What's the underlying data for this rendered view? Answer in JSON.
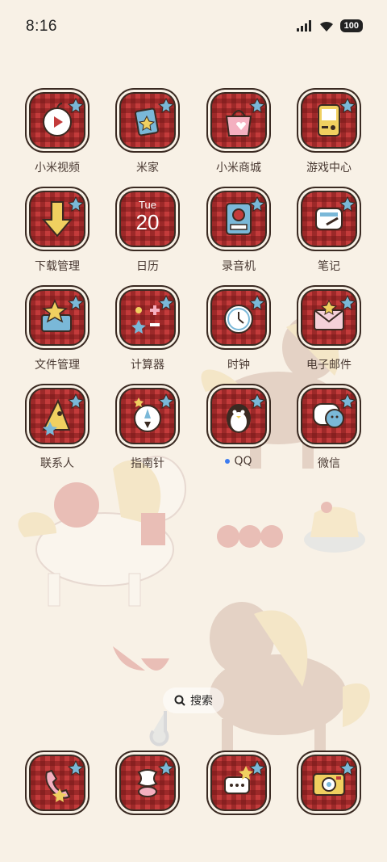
{
  "status_bar": {
    "time": "8:16",
    "battery": "100"
  },
  "apps": [
    {
      "id": "mi-video",
      "label": "小米视频",
      "icon": "apple-video-icon"
    },
    {
      "id": "mi-home",
      "label": "米家",
      "icon": "cup-star-icon"
    },
    {
      "id": "mi-store",
      "label": "小米商城",
      "icon": "shopping-bag-icon"
    },
    {
      "id": "game-center",
      "label": "游戏中心",
      "icon": "gameboy-icon"
    },
    {
      "id": "downloads",
      "label": "下载管理",
      "icon": "download-arrow-icon"
    },
    {
      "id": "calendar",
      "label": "日历",
      "icon": "calendar-icon"
    },
    {
      "id": "recorder",
      "label": "录音机",
      "icon": "recorder-icon"
    },
    {
      "id": "notes",
      "label": "笔记",
      "icon": "notepad-icon"
    },
    {
      "id": "files",
      "label": "文件管理",
      "icon": "folder-star-icon"
    },
    {
      "id": "calculator",
      "label": "计算器",
      "icon": "calculator-icon"
    },
    {
      "id": "clock",
      "label": "时钟",
      "icon": "clock-icon"
    },
    {
      "id": "mail",
      "label": "电子邮件",
      "icon": "envelope-icon"
    },
    {
      "id": "contacts",
      "label": "联系人",
      "icon": "contacts-icon"
    },
    {
      "id": "compass",
      "label": "指南针",
      "icon": "compass-icon"
    },
    {
      "id": "qq",
      "label": "QQ",
      "icon": "penguin-icon"
    },
    {
      "id": "wechat",
      "label": "微信",
      "icon": "chat-bubble-icon"
    }
  ],
  "calendar": {
    "day": "Tue",
    "date": "20"
  },
  "search": {
    "label": "搜索"
  },
  "dock": [
    {
      "id": "phone",
      "icon": "phone-icon"
    },
    {
      "id": "gallery",
      "icon": "apple-core-icon"
    },
    {
      "id": "messages",
      "icon": "message-bubble-icon"
    },
    {
      "id": "camera",
      "icon": "camera-icon"
    }
  ],
  "colors": {
    "background": "#f8f1e6",
    "icon_red": "#c33b3b",
    "outline": "#3a2a22",
    "label": "#4a3a33",
    "notification_dot": "#3d7cf0"
  }
}
